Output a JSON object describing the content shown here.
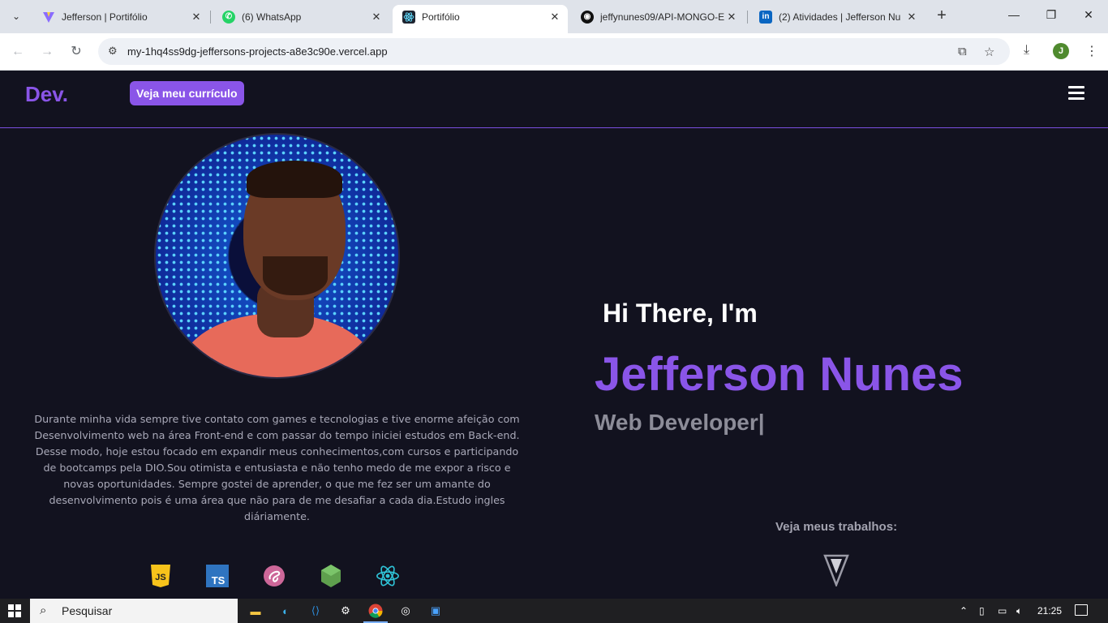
{
  "browser": {
    "tabs": [
      {
        "title": "Jefferson | Portifólio",
        "favicon": "vite-icon",
        "active": false
      },
      {
        "title": "(6) WhatsApp",
        "favicon": "whatsapp-icon",
        "active": false
      },
      {
        "title": "Portifólio",
        "favicon": "react-icon",
        "active": true
      },
      {
        "title": "jeffynunes09/API-MONGO-E",
        "favicon": "github-icon",
        "active": false
      },
      {
        "title": "(2) Atividades | Jefferson Nu",
        "favicon": "linkedin-icon",
        "active": false
      }
    ],
    "url": "my-1hq4ss9dg-jeffersons-projects-a8e3c90e.vercel.app",
    "profile_initial": "J"
  },
  "site": {
    "logo": "Dev.",
    "cv_button": "Veja meu currículo",
    "greeting": "Hi There, I'm",
    "name": "Jefferson Nunes",
    "role": "Web Developer|",
    "bio": "Durante minha vida sempre tive contato com games e tecnologias e tive enorme afeição com Desenvolvimento web na área Front-end e com passar do tempo iniciei estudos em Back-end. Desse modo, hoje estou focado em expandir meus conhecimentos,com cursos e participando de bootcamps pela DIO.Sou otimista e entusiasta e não tenho medo de me expor a risco e novas oportunidades. Sempre gostei de aprender, o que me fez ser um amante do desenvolvimento pois é uma área que não para de me desafiar a cada dia.Estudo ingles diáriamente.",
    "works_label": "Veja meus trabalhos:",
    "skills": [
      {
        "icon": "javascript-icon",
        "label": "JS"
      },
      {
        "icon": "typescript-icon",
        "label": "TS"
      },
      {
        "icon": "sass-icon",
        "label": ""
      },
      {
        "icon": "nodejs-icon",
        "label": ""
      },
      {
        "icon": "react-icon",
        "label": ""
      }
    ],
    "colors": {
      "accent": "#8a55e8",
      "background": "#12121f"
    }
  },
  "taskbar": {
    "search_placeholder": "Pesquisar",
    "time": "21:25"
  }
}
